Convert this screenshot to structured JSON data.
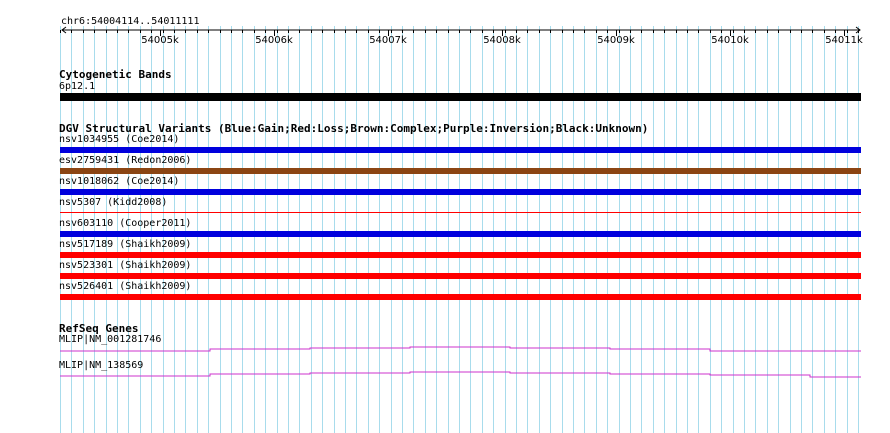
{
  "ruler": {
    "location": "chr6:54004114..54011111",
    "ticks": [
      "54005k",
      "54006k",
      "54007k",
      "54008k",
      "54009k",
      "54010k",
      "54011k"
    ]
  },
  "cytoband": {
    "title": "Cytogenetic Bands",
    "band_label": "6p12.1",
    "color": "#000000"
  },
  "dgv": {
    "title": "DGV Structural Variants (Blue:Gain;Red:Loss;Brown:Complex;Purple:Inversion;Black:Unknown)",
    "variants": [
      {
        "label": "nsv1034955 (Coe2014)",
        "color": "#0000dd",
        "type": "Gain"
      },
      {
        "label": "esv2759431 (Redon2006)",
        "color": "#8b4513",
        "type": "Complex"
      },
      {
        "label": "nsv1018062 (Coe2014)",
        "color": "#0000dd",
        "type": "Gain"
      },
      {
        "label": "nsv5307 (Kidd2008)",
        "color": "#ff0000",
        "type": "Loss"
      },
      {
        "label": "nsv603110 (Cooper2011)",
        "color": "#0000dd",
        "type": "Gain"
      },
      {
        "label": "nsv517189 (Shaikh2009)",
        "color": "#ff0000",
        "type": "Loss"
      },
      {
        "label": "nsv523301 (Shaikh2009)",
        "color": "#ff0000",
        "type": "Loss"
      },
      {
        "label": "nsv526401 (Shaikh2009)",
        "color": "#ff0000",
        "type": "Loss"
      }
    ]
  },
  "refseq": {
    "title": "RefSeq Genes",
    "color": "#cc33cc",
    "genes": [
      {
        "label": "MLIP|NM_001281746"
      },
      {
        "label": "MLIP|NM_138569"
      }
    ]
  },
  "colors": {
    "grid_line": "#a8dcec",
    "gain": "#0000dd",
    "loss": "#ff0000",
    "complex": "#8b4513"
  }
}
